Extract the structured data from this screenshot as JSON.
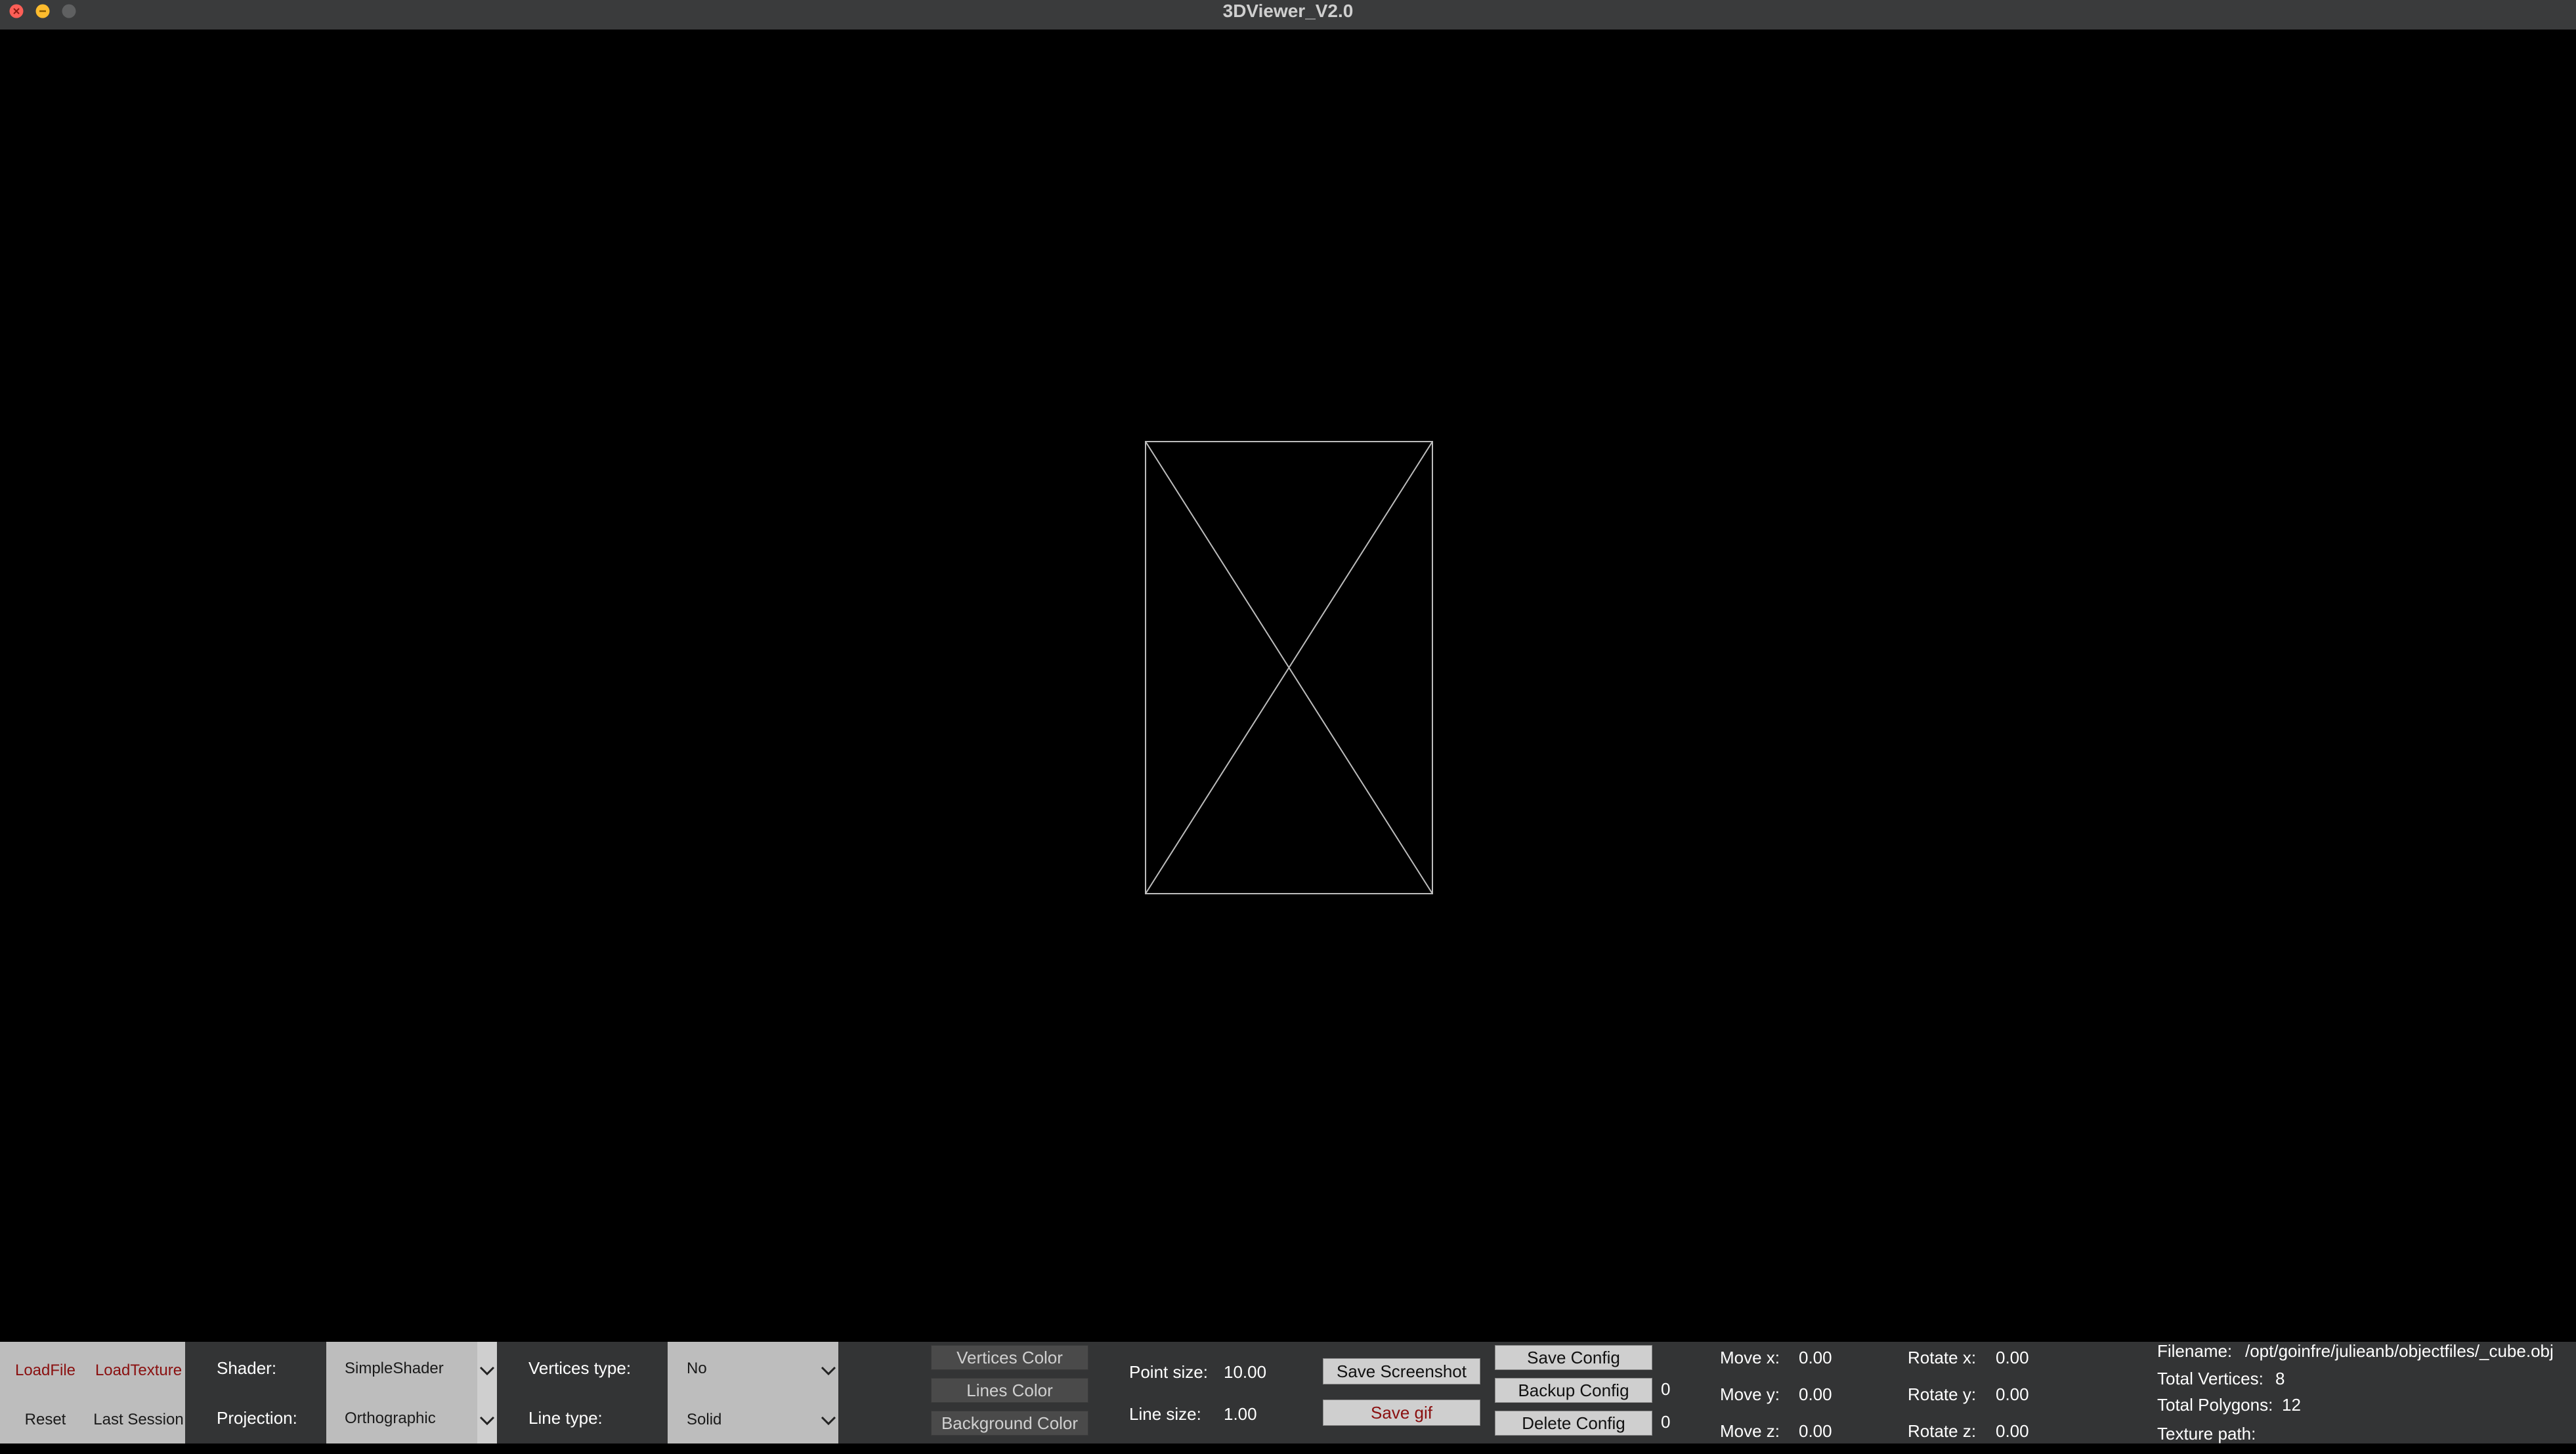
{
  "window": {
    "title": "3DViewer_V2.0"
  },
  "colors": {
    "close": "#fe5f57",
    "minimize": "#febc2e",
    "maximize": "#5f6061"
  },
  "file_buttons": {
    "load_file": "LoadFile",
    "load_texture": "LoadTexture",
    "reset": "Reset",
    "last_session": "Last Session"
  },
  "render": {
    "shader_label": "Shader:",
    "shader_value": "SimpleShader",
    "projection_label": "Projection:",
    "projection_value": "Orthographic",
    "vertices_type_label": "Vertices type:",
    "vertices_type_value": "No",
    "line_type_label": "Line type:",
    "line_type_value": "Solid"
  },
  "color_buttons": {
    "vertices": "Vertices Color",
    "lines": "Lines Color",
    "background": "Background Color"
  },
  "sizes": {
    "point_label": "Point size:",
    "point_value": "10.00",
    "line_label": "Line size:",
    "line_value": "1.00"
  },
  "capture": {
    "screenshot": "Save Screenshot",
    "gif": "Save gif"
  },
  "config": {
    "save": "Save Config",
    "backup": "Backup Config",
    "delete": "Delete Config",
    "backup_index": "0",
    "delete_index": "0"
  },
  "transform": {
    "move_x_label": "Move x:",
    "move_x": "0.00",
    "move_y_label": "Move y:",
    "move_y": "0.00",
    "move_z_label": "Move z:",
    "move_z": "0.00",
    "rot_x_label": "Rotate x:",
    "rot_x": "0.00",
    "rot_y_label": "Rotate y:",
    "rot_y": "0.00",
    "rot_z_label": "Rotate z:",
    "rot_z": "0.00"
  },
  "info": {
    "filename_label": "Filename:",
    "filename": "/opt/goinfre/julieanb/objectfiles/_cube.obj",
    "vertices_label": "Total Vertices:",
    "vertices": "8",
    "polygons_label": "Total Polygons:",
    "polygons": "12",
    "texture_label": "Texture path:"
  }
}
